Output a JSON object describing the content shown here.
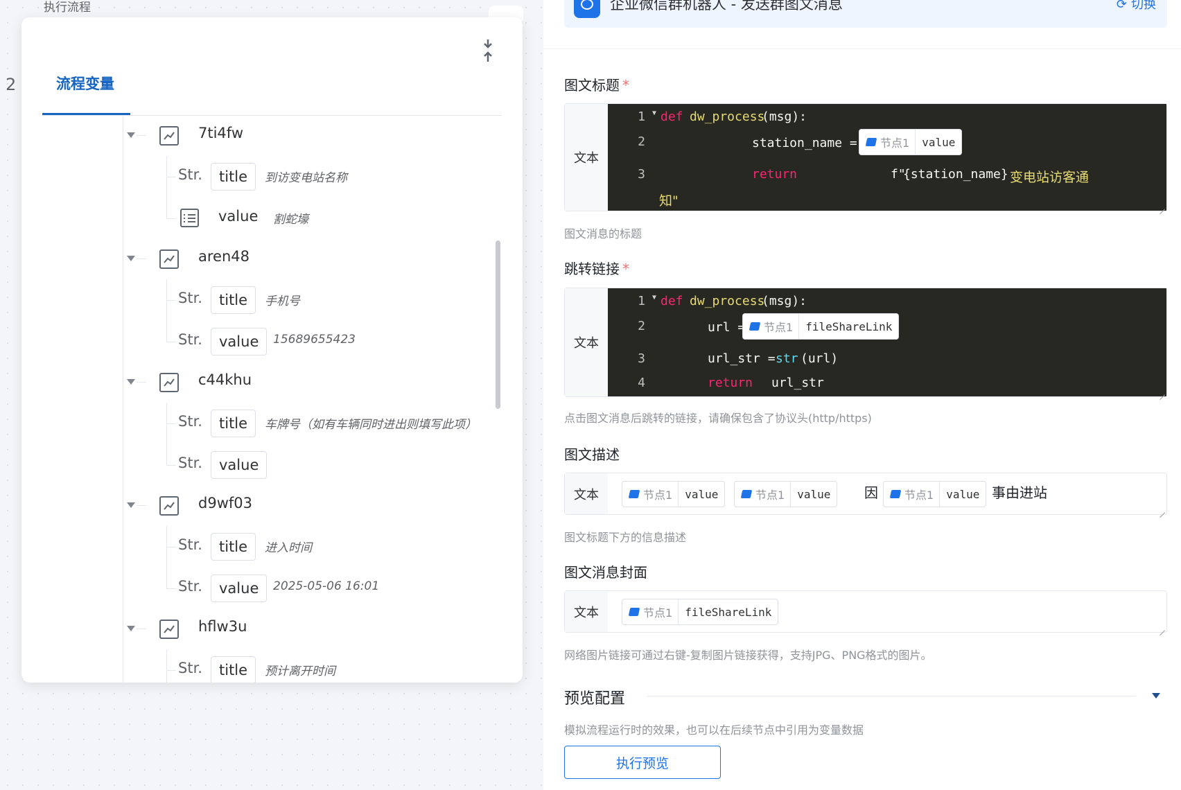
{
  "canvas": {
    "title": "执行流程",
    "number": "2"
  },
  "var_panel": {
    "tab_label": "流程变量",
    "groups": [
      {
        "name": "7ti4fw",
        "items": [
          {
            "type": "Str.",
            "key": "title",
            "value": "到访变电站名称"
          },
          {
            "type": "list",
            "key": "value",
            "value": "割蛇壕"
          }
        ]
      },
      {
        "name": "aren48",
        "items": [
          {
            "type": "Str.",
            "key": "title",
            "value": "手机号"
          },
          {
            "type": "Str.",
            "key": "value",
            "value": "15689655423"
          }
        ]
      },
      {
        "name": "c44khu",
        "items": [
          {
            "type": "Str.",
            "key": "title",
            "value": "车牌号（如有车辆同时进出则填写此项）"
          },
          {
            "type": "Str.",
            "key": "value",
            "value": ""
          }
        ]
      },
      {
        "name": "d9wf03",
        "items": [
          {
            "type": "Str.",
            "key": "title",
            "value": "进入时间"
          },
          {
            "type": "Str.",
            "key": "value",
            "value": "2025-05-06 16:01"
          }
        ]
      },
      {
        "name": "hflw3u",
        "items": [
          {
            "type": "Str.",
            "key": "title",
            "value": "预计离开时间"
          }
        ]
      }
    ]
  },
  "config": {
    "node_title": "企业微信群机器人 - 发送群图文消息",
    "switch_label": "切换",
    "mode_label": "文本",
    "chip_node": "节点1",
    "fields": {
      "title": {
        "label": "图文标题",
        "required": "*",
        "help": "图文消息的标题",
        "code": {
          "def": "def",
          "fn": "dw_process",
          "args": "(msg):",
          "assign_var": "station_name =",
          "chip_var": "value",
          "return_kw": "return",
          "fstring_prefix": "f\"",
          "fstring_var": "{station_name}",
          "fstring_text": "变电站访客通",
          "fstring_end": "知\""
        }
      },
      "link": {
        "label": "跳转链接",
        "required": "*",
        "help": "点击图文消息后跳转的链接，请确保包含了协议头(http/https)",
        "code": {
          "def": "def",
          "fn": "dw_process",
          "args": "(msg):",
          "assign_var": "url =",
          "chip_var": "fileShareLink",
          "l3_var": "url_str =",
          "l3_fn": "str",
          "l3_arg": "(url)",
          "return_kw": "return",
          "return_val": "url_str"
        }
      },
      "desc": {
        "label": "图文描述",
        "help": "图文标题下方的信息描述",
        "chips": [
          "value",
          "value",
          "value"
        ],
        "text1": "因",
        "text2": "事由进站"
      },
      "cover": {
        "label": "图文消息封面",
        "help": "网络图片链接可通过右键-复制图片链接获得，支持JPG、PNG格式的图片。",
        "chip_var": "fileShareLink"
      }
    },
    "preview": {
      "title": "预览配置",
      "help": "模拟流程运行时的效果，也可以在后续节点中引用为变量数据",
      "run_label": "执行预览"
    }
  }
}
